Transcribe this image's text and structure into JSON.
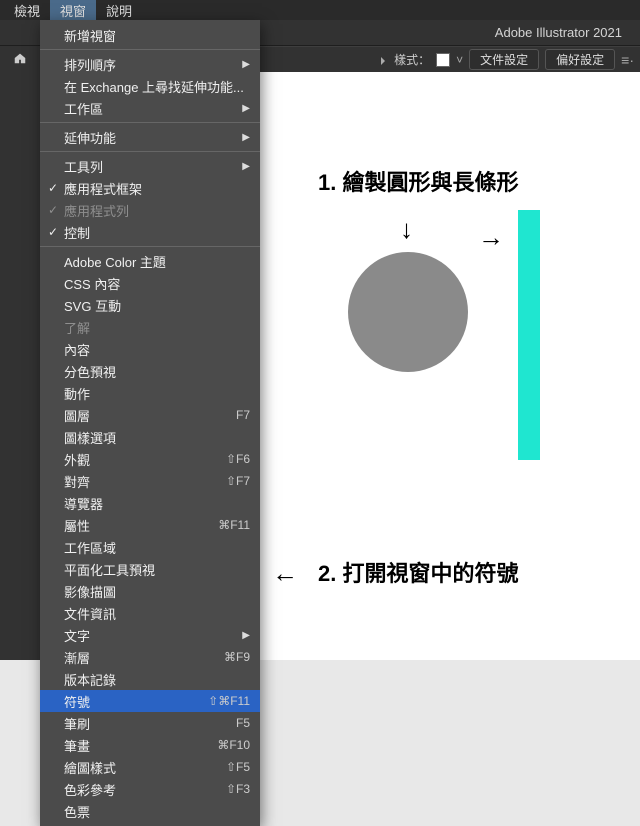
{
  "menubar": {
    "items": [
      "檢視",
      "視窗",
      "說明"
    ],
    "active_index": 1
  },
  "titlebar": {
    "app_title": "Adobe Illustrator 2021"
  },
  "optionsbar": {
    "style_label": "樣式：",
    "btn_doc_setup": "文件設定",
    "btn_pref": "偏好設定"
  },
  "dropdown": {
    "groups": [
      {
        "items": [
          {
            "label": "新增視窗"
          }
        ]
      },
      {
        "items": [
          {
            "label": "排列順序",
            "submenu": true
          },
          {
            "label": "在 Exchange 上尋找延伸功能..."
          },
          {
            "label": "工作區",
            "submenu": true
          }
        ]
      },
      {
        "items": [
          {
            "label": "延伸功能",
            "submenu": true
          }
        ]
      },
      {
        "items": [
          {
            "label": "工具列",
            "submenu": true
          },
          {
            "label": "應用程式框架",
            "checked": true
          },
          {
            "label": "應用程式列",
            "checked": true,
            "disabled": true
          },
          {
            "label": "控制",
            "checked": true
          }
        ]
      },
      {
        "items": [
          {
            "label": "Adobe Color 主題"
          },
          {
            "label": "CSS 內容"
          },
          {
            "label": "SVG 互動"
          },
          {
            "label": "了解",
            "disabled": true
          },
          {
            "label": "內容"
          },
          {
            "label": "分色預視"
          },
          {
            "label": "動作"
          },
          {
            "label": "圖層",
            "shortcut": "F7"
          },
          {
            "label": "圖樣選項"
          },
          {
            "label": "外觀",
            "shortcut": "⇧F6"
          },
          {
            "label": "對齊",
            "shortcut": "⇧F7"
          },
          {
            "label": "導覽器"
          },
          {
            "label": "屬性",
            "shortcut": "⌘F11"
          },
          {
            "label": "工作區域"
          },
          {
            "label": "平面化工具預視"
          },
          {
            "label": "影像描圖"
          },
          {
            "label": "文件資訊"
          },
          {
            "label": "文字",
            "submenu": true
          },
          {
            "label": "漸層",
            "shortcut": "⌘F9"
          },
          {
            "label": "版本記錄"
          },
          {
            "label": "符號",
            "shortcut": "⇧⌘F11",
            "highlight": true
          },
          {
            "label": "筆刷",
            "shortcut": "F5"
          },
          {
            "label": "筆畫",
            "shortcut": "⌘F10"
          },
          {
            "label": "繪圖樣式",
            "shortcut": "⇧F5"
          },
          {
            "label": "色彩參考",
            "shortcut": "⇧F3"
          },
          {
            "label": "色票"
          }
        ]
      }
    ]
  },
  "annotations": {
    "step1": "1. 繪製圓形與長條形",
    "step2": "2. 打開視窗中的符號"
  }
}
